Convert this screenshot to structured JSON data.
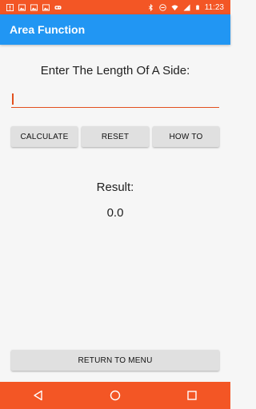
{
  "status_bar": {
    "time": "11:23",
    "left_icons": [
      "alert-icon",
      "photo-icon",
      "photo-icon",
      "photo-icon",
      "gamepad-icon"
    ],
    "right_icons": [
      "bluetooth-icon",
      "minus-circle-icon",
      "wifi-icon",
      "signal-icon",
      "battery-icon"
    ]
  },
  "app_bar": {
    "title": "Area Function"
  },
  "main": {
    "prompt": "Enter The Length Of A Side:",
    "input_value": "",
    "buttons": {
      "calculate": "CALCULATE",
      "reset": "RESET",
      "how_to": "HOW TO"
    },
    "result_label": "Result:",
    "result_value": "0.0",
    "return_button": "RETURN TO MENU"
  },
  "nav_bar": {
    "icons": [
      "back-icon",
      "home-icon",
      "recents-icon"
    ]
  },
  "colors": {
    "accent": "#f35625",
    "primary": "#2196f3",
    "input_line": "#e2501e",
    "button_bg": "#e0e0e0"
  }
}
